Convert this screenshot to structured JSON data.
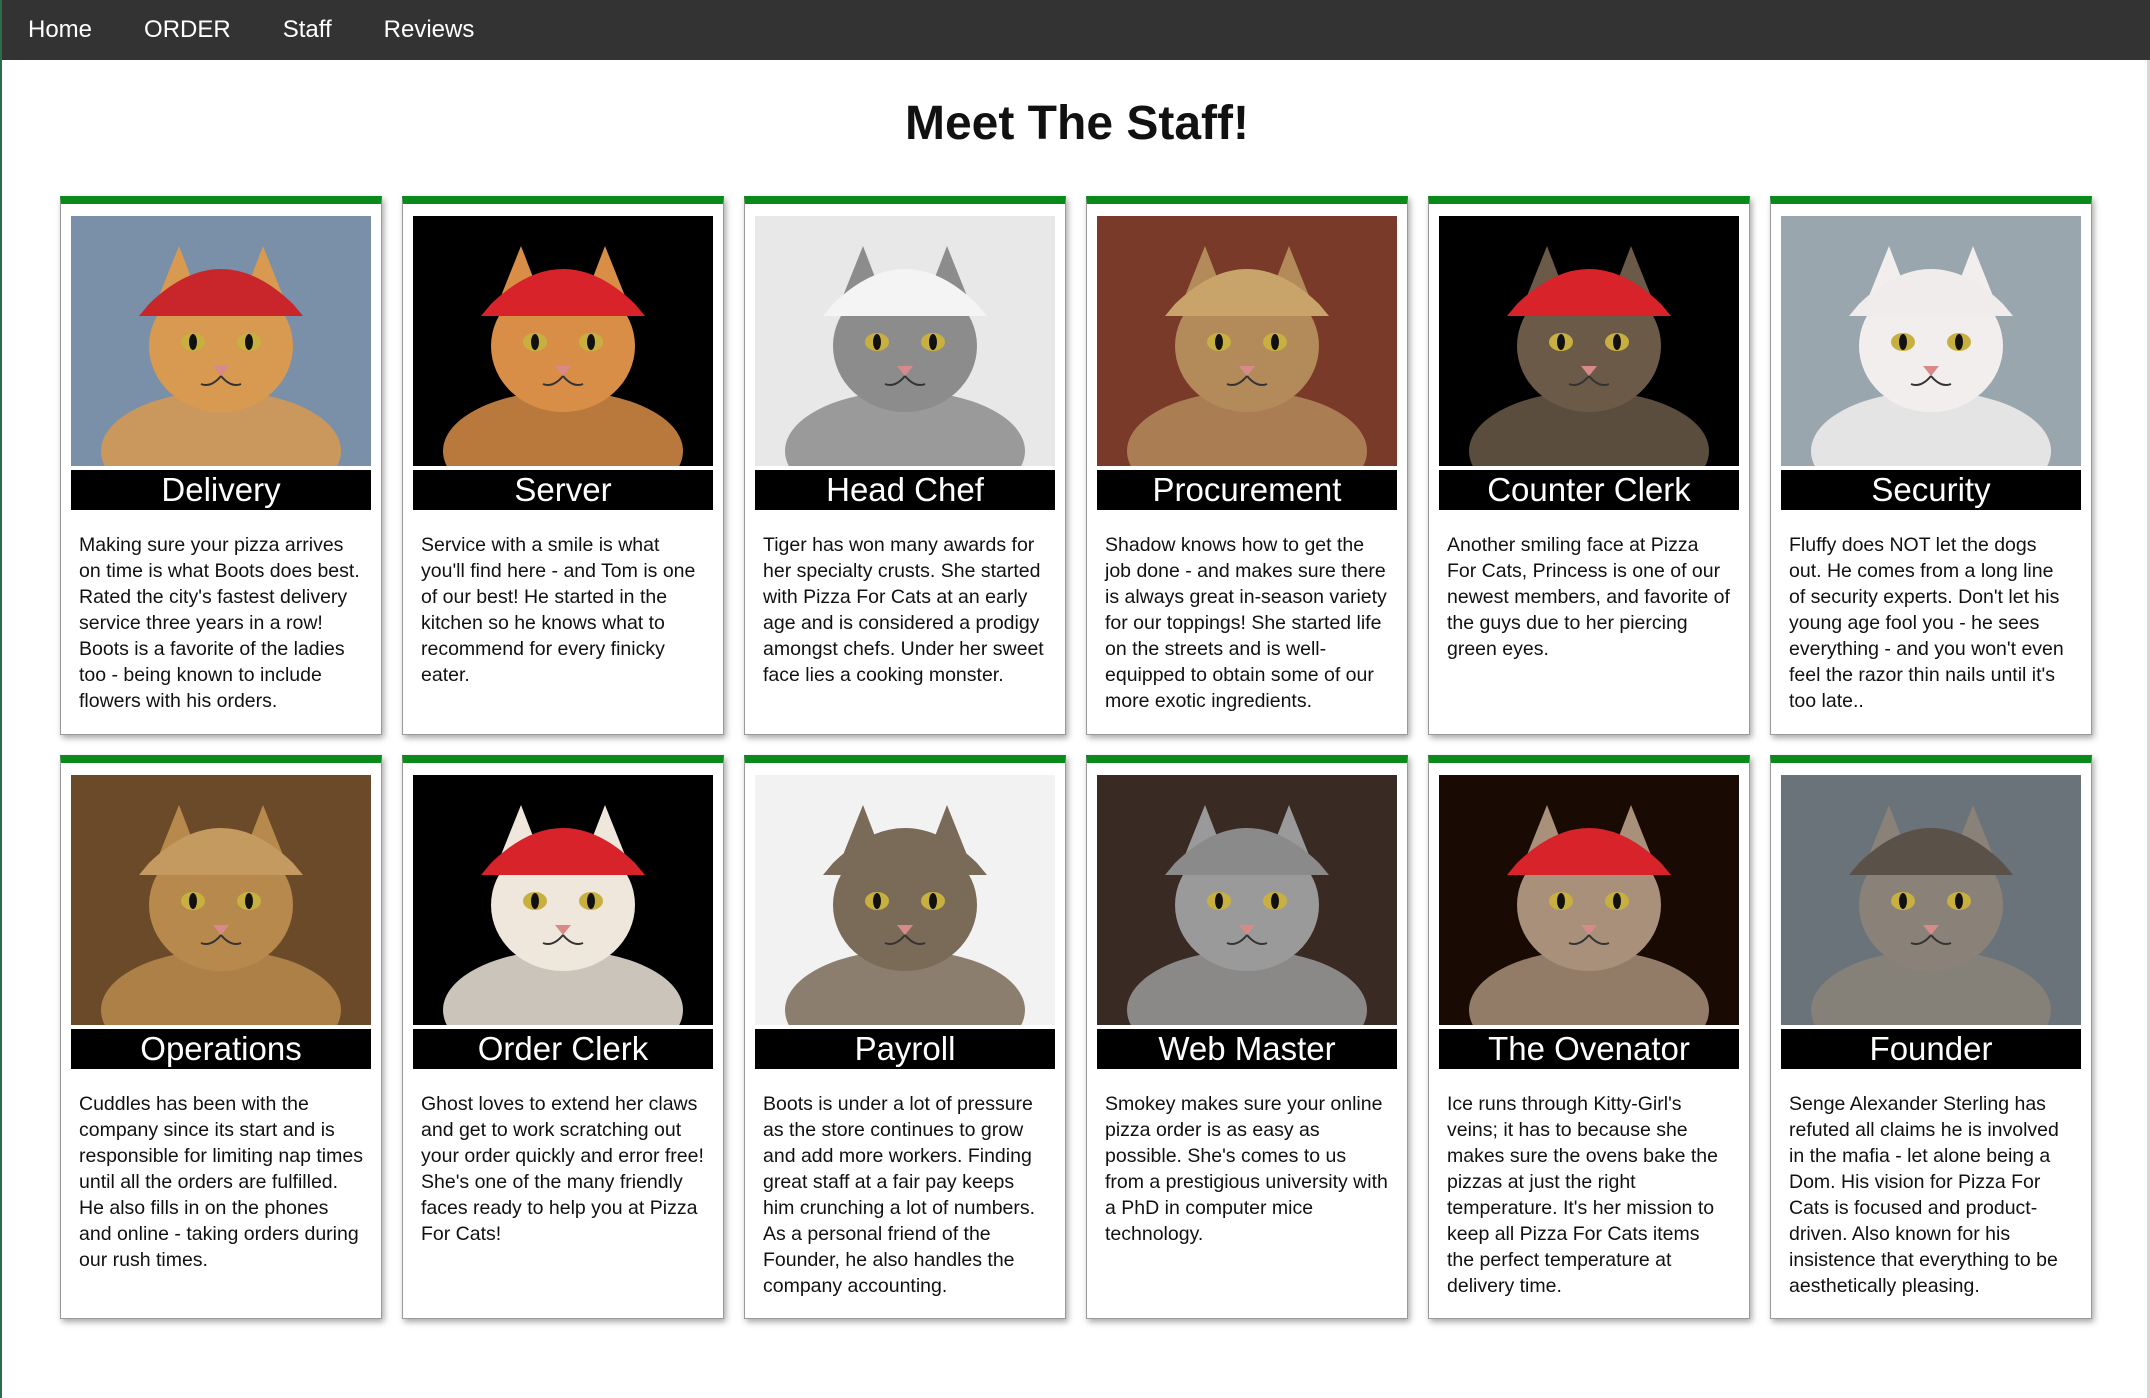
{
  "nav": {
    "items": [
      {
        "label": "Home"
      },
      {
        "label": "ORDER"
      },
      {
        "label": "Staff"
      },
      {
        "label": "Reviews"
      }
    ]
  },
  "page": {
    "title": "Meet The Staff!"
  },
  "colors": {
    "accent": "#0a8a1a",
    "navbar": "#333333",
    "role_bar": "#000000"
  },
  "staff": [
    {
      "role": "Delivery",
      "photo_icon": "delivery-cat-photo",
      "bg": "#7a8fa8",
      "hat": "#c8262b",
      "fur": "#d89a50",
      "desc": "Making sure your pizza arrives on time is what Boots does best. Rated the city's fastest delivery service three years in a row! Boots is a favorite of the ladies too - being known to include flowers with his orders."
    },
    {
      "role": "Server",
      "photo_icon": "server-cat-photo",
      "bg": "#000000",
      "hat": "#d8232a",
      "fur": "#d98e48",
      "desc": "Service with a smile is what you'll find here - and Tom is one of our best! He started in the kitchen so he knows what to recommend for every finicky eater."
    },
    {
      "role": "Head Chef",
      "photo_icon": "chef-cat-photo",
      "bg": "#e8e8e8",
      "hat": "#f4f4f4",
      "fur": "#8c8c8c",
      "desc": "Tiger has won many awards for her specialty crusts. She started with Pizza For Cats at an early age and is considered a prodigy amongst chefs. Under her sweet face lies a cooking monster."
    },
    {
      "role": "Procurement",
      "photo_icon": "procurement-cat-photo",
      "bg": "#7a3a2a",
      "hat": "#c9a46a",
      "fur": "#b38a5a",
      "desc": "Shadow knows how to get the job done - and makes sure there is always great in-season variety for our toppings! She started life on the streets and is well-equipped to obtain some of our more exotic ingredients."
    },
    {
      "role": "Counter Clerk",
      "photo_icon": "counter-clerk-cat-photo",
      "bg": "#000000",
      "hat": "#d8232a",
      "fur": "#6b5a48",
      "desc": "Another smiling face at Pizza For Cats, Princess is one of our newest members, and favorite of the guys due to her piercing green eyes."
    },
    {
      "role": "Security",
      "photo_icon": "security-cat-photo",
      "bg": "#9aa6ad",
      "hat": "#f0ecec",
      "fur": "#f2eeee",
      "desc": "Fluffy does NOT let the dogs out. He comes from a long line of security experts. Don't let his young age fool you - he sees everything - and you won't even feel the razor thin nails until it's too late.."
    },
    {
      "role": "Operations",
      "photo_icon": "operations-cat-photo",
      "bg": "#6b4a2a",
      "hat": "#c49a60",
      "fur": "#b8894c",
      "desc": "Cuddles has been with the company since its start and is responsible for limiting nap times until all the orders are fulfilled. He also fills in on the phones and online - taking orders during our rush times."
    },
    {
      "role": "Order Clerk",
      "photo_icon": "order-clerk-cat-photo",
      "bg": "#000000",
      "hat": "#d8232a",
      "fur": "#efe6dc",
      "desc": "Ghost loves to extend her claws and get to work scratching out your order quickly and error free! She's one of the many friendly faces ready to help you at Pizza For Cats!"
    },
    {
      "role": "Payroll",
      "photo_icon": "payroll-cat-photo",
      "bg": "#f2f2f2",
      "hat": "#7a6a58",
      "fur": "#7a6a58",
      "desc": "Boots is under a lot of pressure as the store continues to grow and add more workers. Finding great staff at a fair pay keeps him crunching a lot of numbers. As a personal friend of the Founder, he also handles the company accounting."
    },
    {
      "role": "Web Master",
      "photo_icon": "web-master-cat-photo",
      "bg": "#3a2a24",
      "hat": "#8a8a8a",
      "fur": "#9a9a9a",
      "desc": "Smokey makes sure your online pizza order is as easy as possible. She's comes to us from a prestigious university with a PhD in computer mice technology."
    },
    {
      "role": "The Ovenator",
      "photo_icon": "ovenator-cat-photo",
      "bg": "#1a0a04",
      "hat": "#d8232a",
      "fur": "#a8907a",
      "desc": "Ice runs through Kitty-Girl's veins; it has to because she makes sure the ovens bake the pizzas at just the right temperature. It's her mission to keep all Pizza For Cats items the perfect temperature at delivery time."
    },
    {
      "role": "Founder",
      "photo_icon": "founder-cat-photo",
      "bg": "#6a727a",
      "hat": "#5a5248",
      "fur": "#8a8278",
      "desc": "Senge Alexander Sterling has refuted all claims he is involved in the mafia - let alone being a Dom. His vision for Pizza For Cats is focused and product-driven. Also known for his insistence that everything to be aesthetically pleasing."
    }
  ]
}
